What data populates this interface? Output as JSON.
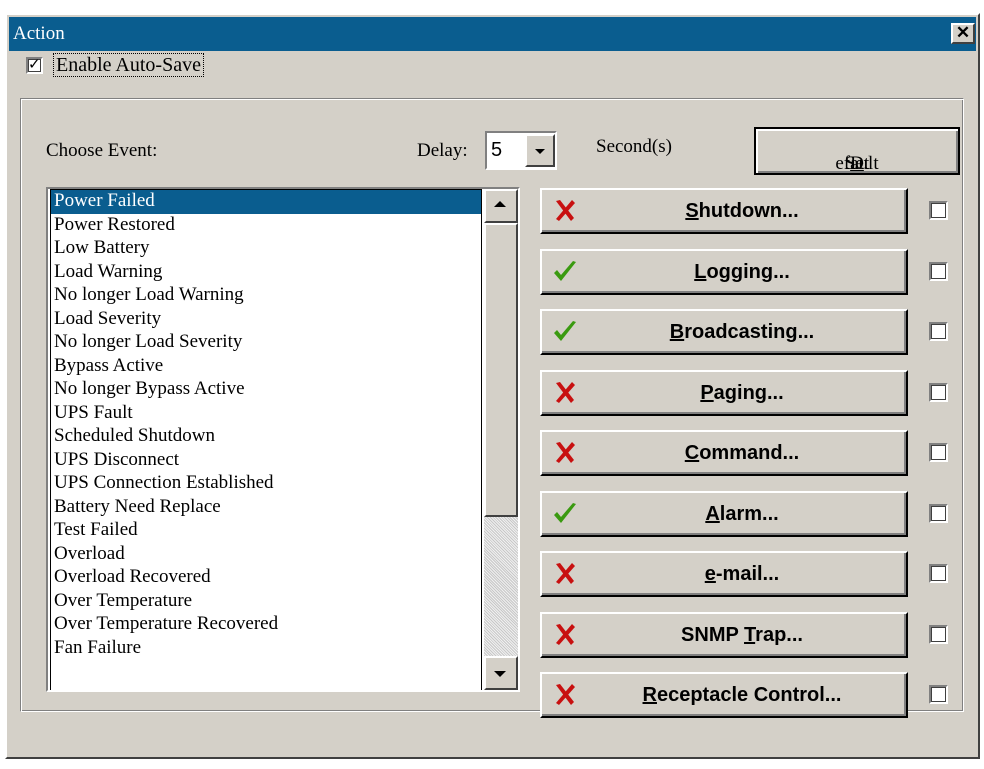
{
  "window": {
    "title": "Action",
    "close_glyph": "✕"
  },
  "autosave": {
    "label": "Enable Auto-Save",
    "checked": true,
    "mark": "✓"
  },
  "choose_event_label": "Choose Event:",
  "delay": {
    "label": "Delay:",
    "value": "5",
    "unit_label": "Second(s)"
  },
  "set_default": {
    "pre": "Set ",
    "ul": "D",
    "post": "efault"
  },
  "events": [
    "Power Failed",
    "Power Restored",
    "Low Battery",
    "Load Warning",
    "No longer Load Warning",
    "Load Severity",
    "No longer Load Severity",
    "Bypass Active",
    "No longer Bypass Active",
    "UPS Fault",
    "Scheduled Shutdown",
    "UPS Disconnect",
    "UPS Connection Established",
    "Battery Need Replace",
    "Test Failed",
    "Overload",
    "Overload Recovered",
    "Over Temperature",
    "Over Temperature Recovered",
    "Fan Failure"
  ],
  "selected_event": "Power Failed",
  "actions": [
    {
      "pre": "",
      "ul": "S",
      "post": "hutdown...",
      "status": "disabled",
      "status_icon": "red-x-icon"
    },
    {
      "pre": "",
      "ul": "L",
      "post": "ogging...",
      "status": "enabled",
      "status_icon": "green-check-icon"
    },
    {
      "pre": "",
      "ul": "B",
      "post": "roadcasting...",
      "status": "enabled",
      "status_icon": "green-check-icon"
    },
    {
      "pre": "",
      "ul": "P",
      "post": "aging...",
      "status": "disabled",
      "status_icon": "red-x-icon"
    },
    {
      "pre": "",
      "ul": "C",
      "post": "ommand...",
      "status": "disabled",
      "status_icon": "red-x-icon"
    },
    {
      "pre": "",
      "ul": "A",
      "post": "larm...",
      "status": "enabled",
      "status_icon": "green-check-icon"
    },
    {
      "pre": "",
      "ul": "e",
      "post": "-mail...",
      "status": "disabled",
      "status_icon": "red-x-icon"
    },
    {
      "pre": "SNMP ",
      "ul": "T",
      "post": "rap...",
      "status": "disabled",
      "status_icon": "red-x-icon"
    },
    {
      "pre": "",
      "ul": "R",
      "post": "eceptacle Control...",
      "status": "disabled",
      "status_icon": "red-x-icon"
    }
  ],
  "colors": {
    "titlebar": "#0a5d8f",
    "selection": "#0a5d8f",
    "face": "#d4d0c8",
    "x_red": "#c81010",
    "check_green": "#3a9a10"
  }
}
